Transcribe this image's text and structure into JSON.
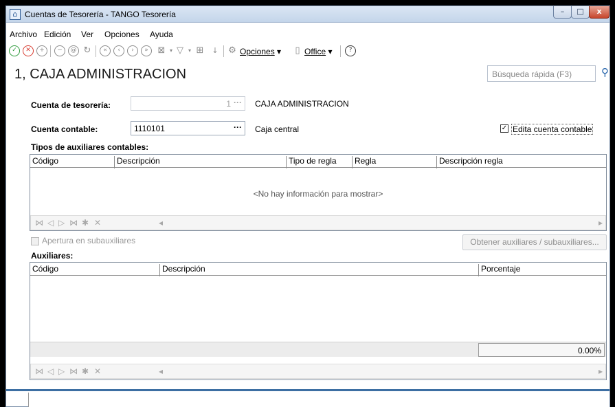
{
  "window": {
    "title": "Cuentas de Tesorería - TANGO Tesorería"
  },
  "menu": [
    "Archivo",
    "Edición",
    "Ver",
    "Opciones",
    "Ayuda"
  ],
  "toolbar": {
    "opciones_label": "Opciones",
    "office_label": "Office"
  },
  "header": {
    "title": "1, CAJA ADMINISTRACION",
    "search_placeholder": "Búsqueda rápida (F3)"
  },
  "form": {
    "cuenta_tesoreria_label": "Cuenta de tesorería:",
    "cuenta_tesoreria_value": "1",
    "cuenta_tesoreria_desc": "CAJA ADMINISTRACION",
    "cuenta_contable_label": "Cuenta contable:",
    "cuenta_contable_value": "1110101",
    "cuenta_contable_desc": "Caja central",
    "edita_label": "Edita cuenta contable",
    "edita_checked": true
  },
  "tipos": {
    "title": "Tipos de auxiliares contables:",
    "columns": [
      "Código",
      "Descripción",
      "Tipo de regla",
      "Regla",
      "Descripción regla"
    ],
    "empty_text": "<No hay información para mostrar>"
  },
  "apertura_label": "Apertura en subauxiliares",
  "obtener_button": "Obtener auxiliares / subauxiliares...",
  "auxiliares": {
    "title": "Auxiliares:",
    "columns": [
      "Código",
      "Descripción",
      "Porcentaje"
    ],
    "total": "0.00%"
  },
  "colors": {
    "accent": "#3d6fa3",
    "ok": "#2e9a3c",
    "cancel": "#d73a2f"
  }
}
